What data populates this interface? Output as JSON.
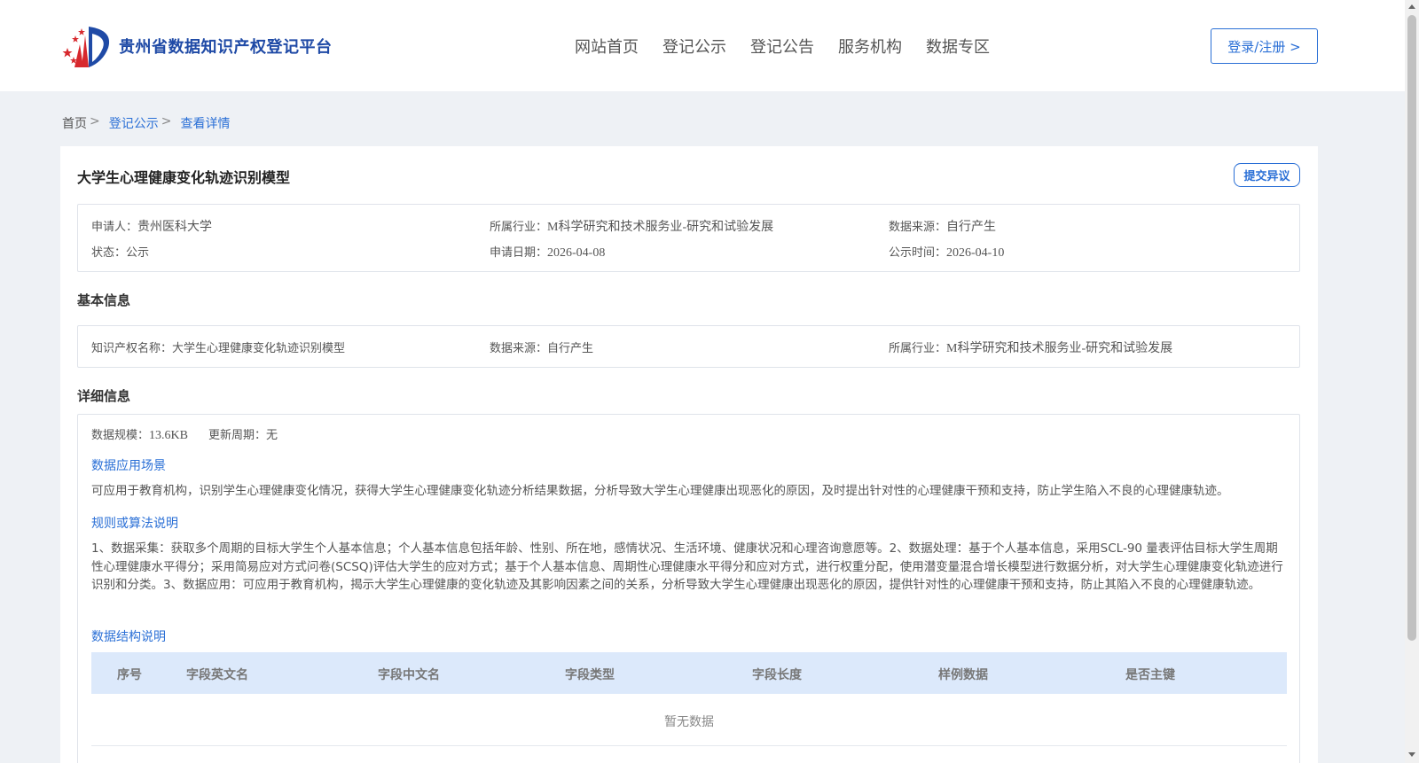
{
  "header": {
    "logo_text": "贵州省数据知识产权登记平台",
    "nav": [
      "网站首页",
      "登记公示",
      "登记公告",
      "服务机构",
      "数据专区"
    ],
    "login_label": "登录/注册 >"
  },
  "breadcrumb": {
    "home": "首页",
    "sep": ">",
    "section": "登记公示",
    "current": "查看详情"
  },
  "detail": {
    "title": "大学生心理健康变化轨迹识别模型",
    "objection_label": "提交异议",
    "summary": {
      "applicant_label": "申请人：",
      "applicant": "贵州医科大学",
      "industry_label": "所属行业：",
      "industry": "M科学研究和技术服务业-研究和试验发展",
      "source_label": "数据来源：",
      "source": "自行产生",
      "status_label": "状态：",
      "status": "公示",
      "apply_date_label": "申请日期：",
      "apply_date": "2026-04-08",
      "publish_time_label": "公示时间：",
      "publish_time": "2026-04-10"
    },
    "basic_info": {
      "heading": "基本信息",
      "ip_name_label": "知识产权名称：",
      "ip_name": "大学生心理健康变化轨迹识别模型",
      "source_label": "数据来源：",
      "source": "自行产生",
      "industry_label": "所属行业：",
      "industry": "M科学研究和技术服务业-研究和试验发展"
    },
    "details": {
      "heading": "详细信息",
      "scale_label": "数据规模：",
      "scale": "13.6KB",
      "cycle_label": "更新周期：",
      "cycle": "无",
      "scenario_title": "数据应用场景",
      "scenario_text": "可应用于教育机构，识别学生心理健康变化情况，获得大学生心理健康变化轨迹分析结果数据，分析导致大学生心理健康出现恶化的原因，及时提出针对性的心理健康干预和支持，防止学生陷入不良的心理健康轨迹。",
      "algorithm_title": "规则或算法说明",
      "algorithm_text": "1、数据采集：获取多个周期的目标大学生个人基本信息；个人基本信息包括年龄、性别、所在地，感情状况、生活环境、健康状况和心理咨询意愿等。2、数据处理：基于个人基本信息，采用SCL-90 量表评估目标大学生周期性心理健康水平得分；采用简易应对方式问卷(SCSQ)评估大学生的应对方式；基于个人基本信息、周期性心理健康水平得分和应对方式，进行权重分配，使用潜变量混合增长模型进行数据分析，对大学生心理健康变化轨迹进行识别和分类。3、数据应用：可应用于教育机构，揭示大学生心理健康的变化轨迹及其影响因素之间的关系，分析导致大学生心理健康出现恶化的原因，提供针对性的心理健康干预和支持，防止其陷入不良的心理健康轨迹。",
      "structure_title": "数据结构说明",
      "table_headers": [
        "序号",
        "字段英文名",
        "字段中文名",
        "字段类型",
        "字段长度",
        "样例数据",
        "是否主键"
      ],
      "empty_text": "暂无数据"
    }
  },
  "colors": {
    "accent": "#2a6fd6",
    "logo_blue": "#1f4aa6",
    "logo_red": "#d7282d",
    "table_head_bg": "#dce9fb",
    "page_bg": "#eef1f5"
  }
}
